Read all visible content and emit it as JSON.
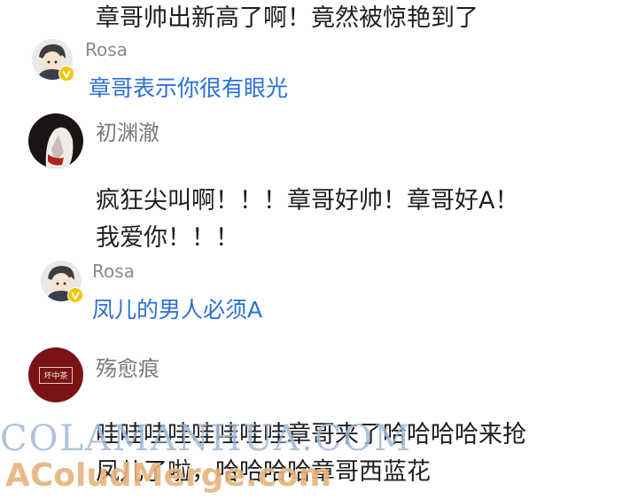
{
  "top_comment": {
    "text": "章哥帅出新高了啊！竟然被惊艳到了"
  },
  "reply1": {
    "author": "Rosa",
    "text": "章哥表示你很有眼光"
  },
  "comment2": {
    "author": "初渊澈",
    "line1": "疯狂尖叫啊！！！章哥好帅！章哥好A！",
    "line2": "我爱你！！！"
  },
  "reply2": {
    "author": "Rosa",
    "text": "凤儿的男人必须A"
  },
  "comment3": {
    "author": "殇愈痕",
    "avatar_text": "坏中茶",
    "line1": "哇哇哇哇哇哇哇哇章哥来了哈哈哈哈来抢",
    "line2": "凤儿了啦，哈哈哈哈章哥西蓝花"
  },
  "watermark": {
    "line1": "COLAMANHUA.COM",
    "line2": "AColudMerge.com"
  },
  "colors": {
    "reply_blue": "#2b6fd6",
    "badge_yellow": "#f3c400",
    "avatar3_bg": "#7a1414"
  }
}
